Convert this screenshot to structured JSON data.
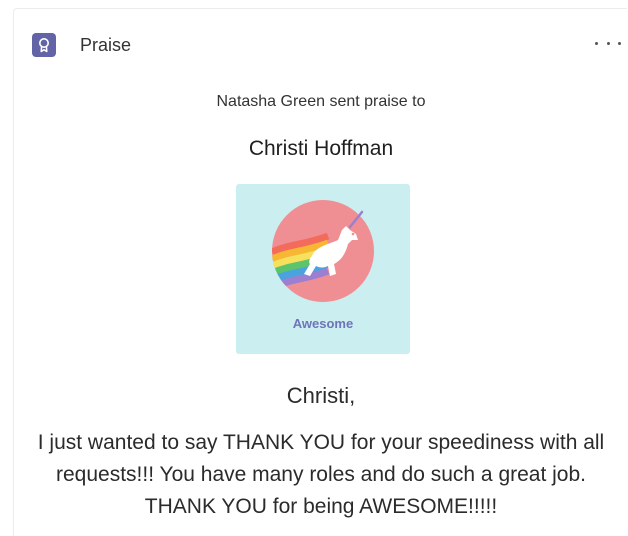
{
  "card": {
    "app_name": "Praise",
    "app_icon": "award-ribbon-icon",
    "more_icon": "more-options-icon"
  },
  "praise": {
    "sender_line": "Natasha Green sent praise to",
    "recipient": "Christi Hoffman",
    "badge": {
      "label": "Awesome",
      "icon": "unicorn-rainbow-icon",
      "colors": {
        "tile_background": "#cbeef1",
        "circle": "#f08f93",
        "label": "#6f74b8"
      }
    },
    "greeting": "Christi,",
    "message": "I just wanted to say THANK YOU for your speediness with all requests!!! You have many roles and do such a great job. THANK YOU for being AWESOME!!!!!"
  },
  "colors": {
    "accent": "#6264a7"
  }
}
